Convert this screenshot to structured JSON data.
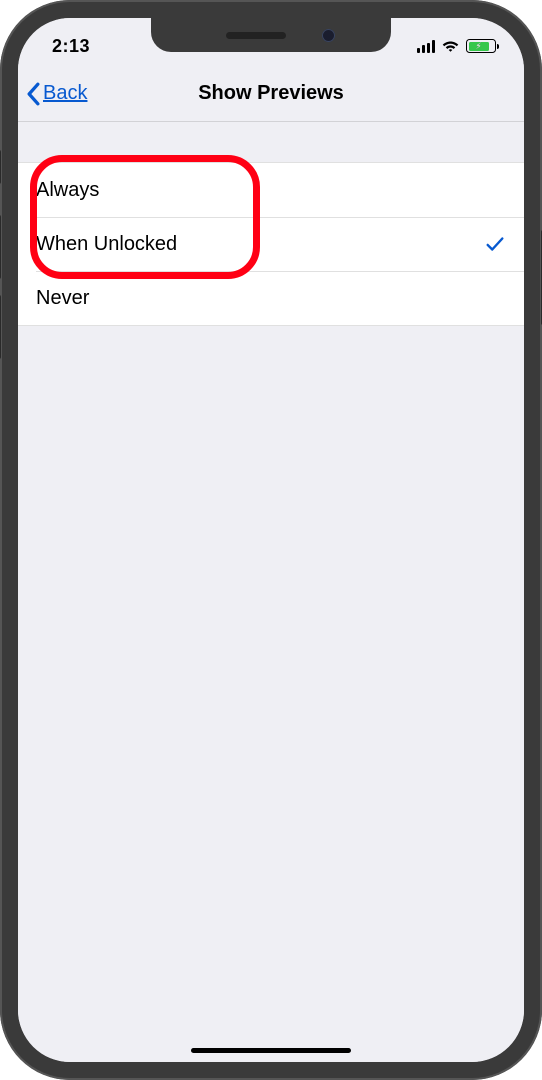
{
  "status": {
    "time": "2:13"
  },
  "nav": {
    "back_label": "Back",
    "title": "Show Previews"
  },
  "options": [
    {
      "label": "Always",
      "selected": false
    },
    {
      "label": "When Unlocked",
      "selected": true
    },
    {
      "label": "Never",
      "selected": false
    }
  ]
}
